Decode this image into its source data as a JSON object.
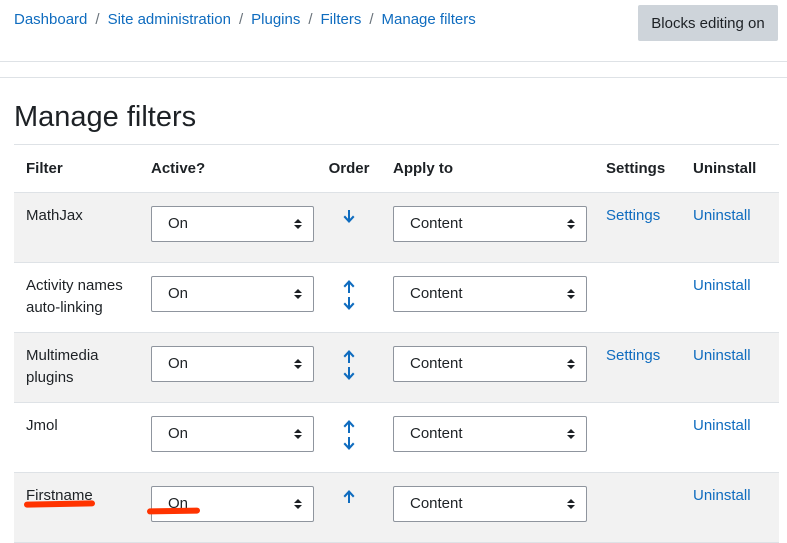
{
  "breadcrumb": [
    "Dashboard",
    "Site administration",
    "Plugins",
    "Filters",
    "Manage filters"
  ],
  "header": {
    "blocks_editing_label": "Blocks editing on"
  },
  "page_title": "Manage filters",
  "table": {
    "headers": {
      "filter": "Filter",
      "active": "Active?",
      "order": "Order",
      "apply_to": "Apply to",
      "settings": "Settings",
      "uninstall": "Uninstall"
    },
    "rows": [
      {
        "name": "MathJax",
        "active": "On",
        "apply_to": "Content",
        "settings": "Settings",
        "uninstall": "Uninstall",
        "can_move_up": false,
        "can_move_down": true
      },
      {
        "name": "Activity names auto-linking",
        "active": "On",
        "apply_to": "Content",
        "settings": "",
        "uninstall": "Uninstall",
        "can_move_up": true,
        "can_move_down": true
      },
      {
        "name": "Multimedia plugins",
        "active": "On",
        "apply_to": "Content",
        "settings": "Settings",
        "uninstall": "Uninstall",
        "can_move_up": true,
        "can_move_down": true
      },
      {
        "name": "Jmol",
        "active": "On",
        "apply_to": "Content",
        "settings": "",
        "uninstall": "Uninstall",
        "can_move_up": true,
        "can_move_down": true
      },
      {
        "name": "Firstname",
        "active": "On",
        "apply_to": "Content",
        "settings": "",
        "uninstall": "Uninstall",
        "can_move_up": true,
        "can_move_down": false
      }
    ]
  },
  "icons": {
    "move_up": "arrow-up-icon",
    "move_down": "arrow-down-icon",
    "select_caret": "sort-caret-icon"
  },
  "colors": {
    "link": "#0f6cbf",
    "annotation": "#ff3300",
    "stripe": "#f2f2f2",
    "button_bg": "#ced4da"
  }
}
